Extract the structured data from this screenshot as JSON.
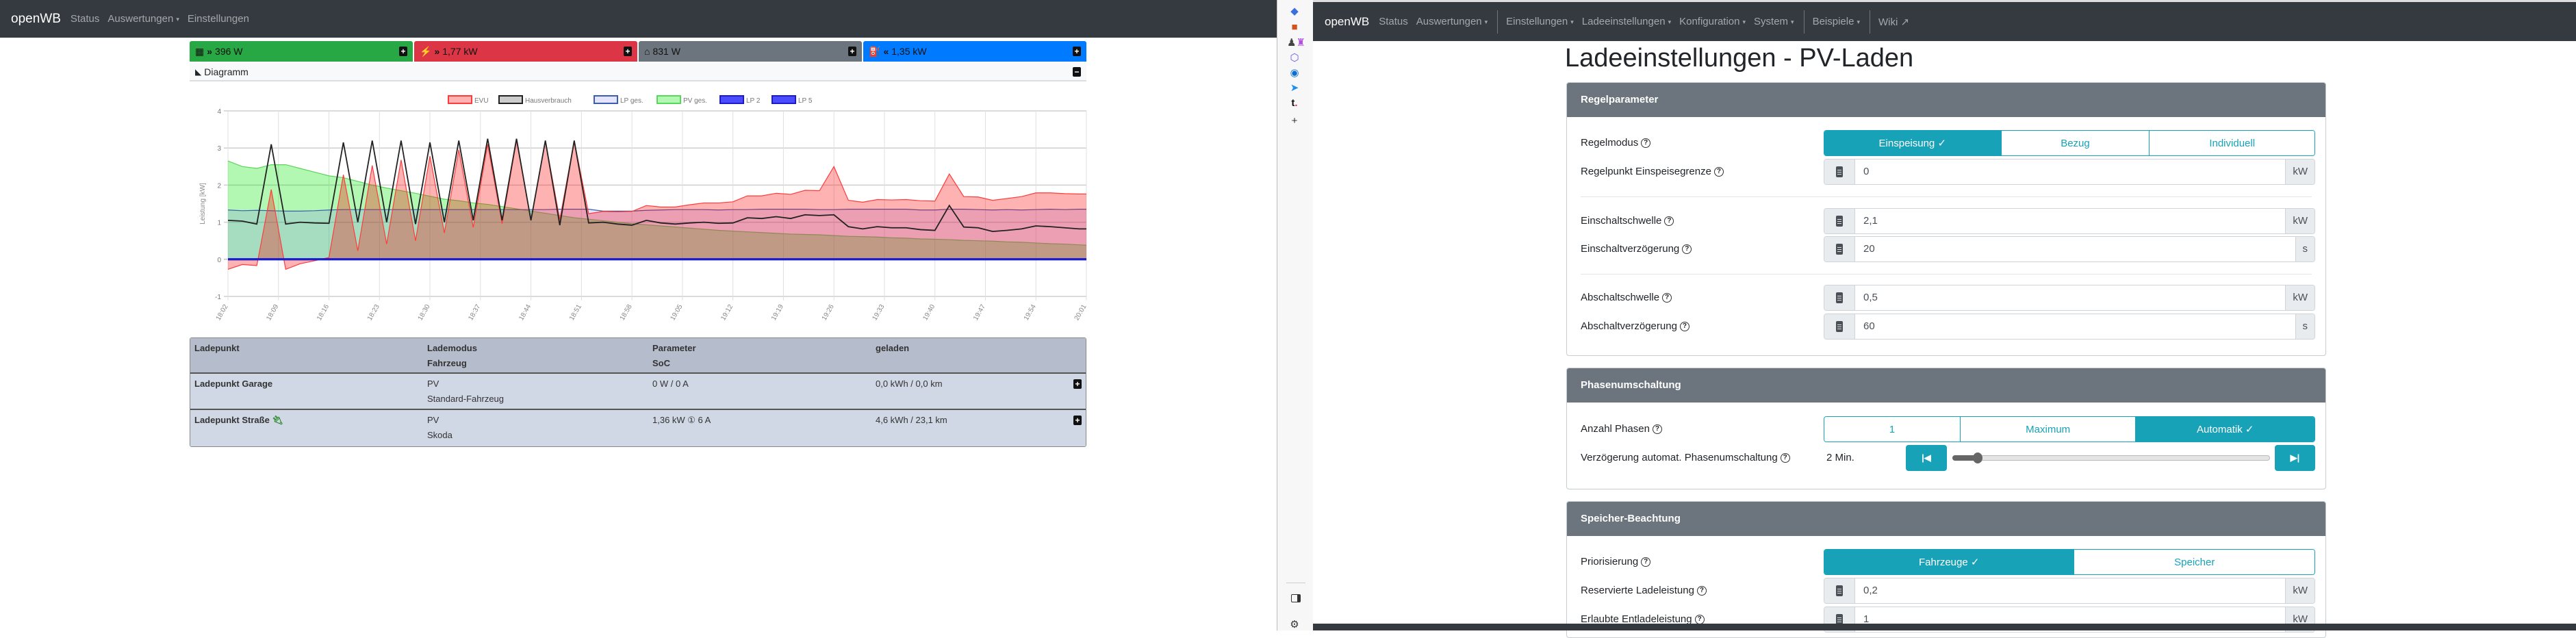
{
  "left_window": {
    "navbar": {
      "brand": "openWB",
      "items": [
        "Status",
        "Auswertungen",
        "Einstellungen"
      ],
      "dropdown_caret": "▾"
    },
    "power_cards": [
      {
        "icon": "solar-panel-icon",
        "arrow": "»",
        "value": "396 W",
        "color": "#28a745"
      },
      {
        "icon": "power-pylon-icon",
        "arrow": "»",
        "value": "1,77 kW",
        "color": "#dc3545"
      },
      {
        "icon": "house-icon",
        "arrow": "",
        "value": "831 W",
        "color": "#6c757d"
      },
      {
        "icon": "charging-station-icon",
        "arrow": "«",
        "value": "1,35 kW",
        "color": "#007bff"
      }
    ],
    "diagram_header": "Diagramm",
    "table": {
      "headers": {
        "c1": "Ladepunkt",
        "c2a": "Lademodus",
        "c2b": "Fahrzeug",
        "c3a": "Parameter",
        "c3b": "SoC",
        "c4": "geladen"
      },
      "rows": [
        {
          "name": "Ladepunkt Garage",
          "mode": "PV",
          "vehicle": "Standard-Fahrzeug",
          "param": "0 W / 0 A",
          "charged": "0,0 kWh / 0,0 km",
          "plugged": false
        },
        {
          "name": "Ladepunkt Straße",
          "mode": "PV",
          "vehicle": "Skoda",
          "param": "1,36 kW ① 6 A",
          "charged": "4,6 kWh / 23,1 km",
          "plugged": true
        }
      ]
    }
  },
  "chart_data": {
    "type": "area",
    "ylabel": "Leistung [kW]",
    "ylim": [
      -1,
      4
    ],
    "yticks": [
      "4",
      "3",
      "2",
      "1",
      "0",
      "-1"
    ],
    "xlim_minutes_after_1802": [
      0,
      119
    ],
    "xticks": [
      "18:02",
      "18:09",
      "18:16",
      "18:23",
      "18:30",
      "18:37",
      "18:44",
      "18:51",
      "18:58",
      "19:05",
      "19:12",
      "19:19",
      "19:26",
      "19:33",
      "19:40",
      "19:47",
      "19:54",
      "20:01"
    ],
    "grid": true,
    "legend_position": "top-center",
    "x": [
      0,
      2,
      4,
      6,
      8,
      10,
      12,
      14,
      16,
      18,
      20,
      22,
      24,
      26,
      28,
      30,
      32,
      34,
      36,
      38,
      40,
      42,
      44,
      46,
      48,
      50,
      52,
      54,
      56,
      58,
      60,
      62,
      64,
      66,
      68,
      70,
      72,
      74,
      76,
      78,
      80,
      82,
      84,
      86,
      88,
      90,
      92,
      94,
      96,
      98,
      100,
      102,
      104,
      106,
      108,
      110,
      112,
      114,
      116,
      118,
      119
    ],
    "series": [
      {
        "name": "EVU",
        "fill": "rgba(255,0,0,0.3)",
        "stroke": "#ff3b3b",
        "values": [
          -0.27,
          -0.14,
          -0.17,
          1.88,
          -0.27,
          -0.12,
          -0.04,
          0.05,
          2.28,
          0.23,
          2.53,
          0.41,
          2.68,
          0.5,
          2.78,
          0.71,
          2.95,
          0.86,
          3.1,
          0.96,
          3.2,
          1.08,
          3.2,
          1.07,
          3.2,
          1.23,
          1.29,
          1.28,
          1.29,
          1.45,
          1.41,
          1.41,
          1.47,
          1.52,
          1.52,
          1.55,
          1.71,
          1.71,
          1.78,
          1.75,
          1.86,
          1.85,
          2.5,
          1.59,
          1.54,
          1.61,
          1.6,
          1.61,
          1.58,
          1.57,
          2.3,
          1.69,
          1.68,
          1.59,
          1.64,
          1.69,
          1.79,
          1.79,
          1.77,
          1.76,
          1.76
        ]
      },
      {
        "name": "Hausverbrauch",
        "fill": "rgba(0,0,0,0.2)",
        "stroke": "#222222",
        "values": [
          1.05,
          1.03,
          0.95,
          3.1,
          0.95,
          1.0,
          0.98,
          0.97,
          3.15,
          1.0,
          3.2,
          1.0,
          3.2,
          0.95,
          3.15,
          1.0,
          3.2,
          1.05,
          3.25,
          1.05,
          3.25,
          1.05,
          3.2,
          0.92,
          3.2,
          0.98,
          1.0,
          0.95,
          0.92,
          1.05,
          0.98,
          0.95,
          0.98,
          1.0,
          0.97,
          0.98,
          1.12,
          1.1,
          1.15,
          1.1,
          1.2,
          1.18,
          1.2,
          0.88,
          0.82,
          0.88,
          0.85,
          0.85,
          0.8,
          0.78,
          1.45,
          0.87,
          0.85,
          0.75,
          0.78,
          0.82,
          0.9,
          0.88,
          0.85,
          0.82,
          0.82
        ]
      },
      {
        "name": "LP ges.",
        "fill": "rgba(120,120,255,0.2)",
        "stroke": "#3a5fb0",
        "values": [
          1.33,
          1.31,
          1.32,
          1.31,
          1.3,
          1.3,
          1.31,
          1.33,
          1.34,
          1.34,
          1.34,
          1.34,
          1.34,
          1.34,
          1.34,
          1.34,
          1.34,
          1.34,
          1.34,
          1.34,
          1.34,
          1.34,
          1.34,
          1.35,
          1.35,
          1.35,
          1.3,
          1.3,
          1.3,
          1.32,
          1.33,
          1.34,
          1.34,
          1.34,
          1.33,
          1.34,
          1.34,
          1.35,
          1.35,
          1.35,
          1.35,
          1.34,
          1.34,
          1.35,
          1.35,
          1.35,
          1.35,
          1.35,
          1.33,
          1.33,
          1.35,
          1.35,
          1.34,
          1.33,
          1.34,
          1.33,
          1.34,
          1.35,
          1.34,
          1.35,
          1.35
        ]
      },
      {
        "name": "PV ges.",
        "fill": "rgba(0,230,0,0.3)",
        "stroke": "#5ad65a",
        "values": [
          2.65,
          2.5,
          2.45,
          2.55,
          2.55,
          2.45,
          2.35,
          2.25,
          2.2,
          2.1,
          2.0,
          1.92,
          1.85,
          1.78,
          1.7,
          1.62,
          1.58,
          1.52,
          1.48,
          1.42,
          1.36,
          1.3,
          1.24,
          1.18,
          1.12,
          1.08,
          1.04,
          1.0,
          0.96,
          0.93,
          0.9,
          0.87,
          0.84,
          0.81,
          0.78,
          0.76,
          0.74,
          0.72,
          0.7,
          0.68,
          0.67,
          0.66,
          0.64,
          0.62,
          0.61,
          0.6,
          0.58,
          0.57,
          0.55,
          0.54,
          0.53,
          0.51,
          0.5,
          0.49,
          0.47,
          0.46,
          0.44,
          0.42,
          0.41,
          0.39,
          0.38
        ]
      },
      {
        "name": "LP 2",
        "fill": "rgba(0,0,255,0.7)",
        "stroke": "#1a1ad0",
        "values": [
          0,
          0,
          0,
          0,
          0,
          0,
          0,
          0,
          0,
          0,
          0,
          0,
          0,
          0,
          0,
          0,
          0,
          0,
          0,
          0,
          0,
          0,
          0,
          0,
          0,
          0,
          0,
          0,
          0,
          0,
          0,
          0,
          0,
          0,
          0,
          0,
          0,
          0,
          0,
          0,
          0,
          0,
          0,
          0,
          0,
          0,
          0,
          0,
          0,
          0,
          0,
          0,
          0,
          0,
          0,
          0,
          0,
          0,
          0,
          0,
          0
        ]
      },
      {
        "name": "LP 5",
        "fill": "rgba(0,0,255,0.7)",
        "stroke": "#1a1ad0",
        "values": [
          0,
          0,
          0,
          0,
          0,
          0,
          0,
          0,
          0,
          0,
          0,
          0,
          0,
          0,
          0,
          0,
          0,
          0,
          0,
          0,
          0,
          0,
          0,
          0,
          0,
          0,
          0,
          0,
          0,
          0,
          0,
          0,
          0,
          0,
          0,
          0,
          0,
          0,
          0,
          0,
          0,
          0,
          0,
          0,
          0,
          0,
          0,
          0,
          0,
          0,
          0,
          0,
          0,
          0,
          0,
          0,
          0,
          0,
          0,
          0,
          0
        ]
      }
    ]
  },
  "right_window": {
    "navbar": {
      "brand": "openWB",
      "items": [
        "Status",
        "Auswertungen",
        "Einstellungen",
        "Ladeeinstellungen",
        "Konfiguration",
        "System",
        "Beispiele",
        "Wiki"
      ],
      "caret": "▾",
      "external_link_glyph": "↗"
    },
    "title": "Ladeeinstellungen - PV-Laden",
    "regel": {
      "header": "Regelparameter",
      "regelmodus_label": "Regelmodus",
      "regelmodus_options": [
        "Einspeisung ✓",
        "Bezug",
        "Individuell"
      ],
      "regelmodus_selected": "Einspeisung",
      "regelpunkt_label": "Regelpunkt Einspeisegrenze",
      "regelpunkt_value": "0",
      "regelpunkt_unit": "kW",
      "ein_schwelle_label": "Einschaltschwelle",
      "ein_schwelle_value": "2,1",
      "ein_schwelle_unit": "kW",
      "ein_verz_label": "Einschaltverzögerung",
      "ein_verz_value": "20",
      "ein_verz_unit": "s",
      "ab_schwelle_label": "Abschaltschwelle",
      "ab_schwelle_value": "0,5",
      "ab_schwelle_unit": "kW",
      "ab_verz_label": "Abschaltverzögerung",
      "ab_verz_value": "60",
      "ab_verz_unit": "s"
    },
    "phasen": {
      "header": "Phasenumschaltung",
      "anzahl_label": "Anzahl Phasen",
      "anzahl_options": [
        "1",
        "Maximum",
        "Automatik ✓"
      ],
      "anzahl_selected": "Automatik",
      "verz_label": "Verzögerung automat. Phasenumschaltung",
      "verz_value": "2 Min.",
      "verz_slider_fraction": 0.08
    },
    "speicher": {
      "header": "Speicher-Beachtung",
      "prio_label": "Priorisierung",
      "prio_options": [
        "Fahrzeuge ✓",
        "Speicher"
      ],
      "prio_selected": "Fahrzeuge",
      "res_label": "Reservierte Ladeleistung",
      "res_value": "0,2",
      "res_unit": "kW",
      "ent_label": "Erlaubte Entladeleistung",
      "ent_value": "1",
      "ent_unit": "kW"
    }
  },
  "browser_sidebar": {
    "icons": [
      "tag-icon",
      "toolbox-icon",
      "chess-icon",
      "copilot-icon",
      "outlook-icon",
      "send-icon",
      "t-app-icon",
      "add-icon"
    ],
    "add_glyph": "+",
    "bottom_icons": [
      "sidebar-toggle-icon",
      "settings-icon"
    ]
  }
}
